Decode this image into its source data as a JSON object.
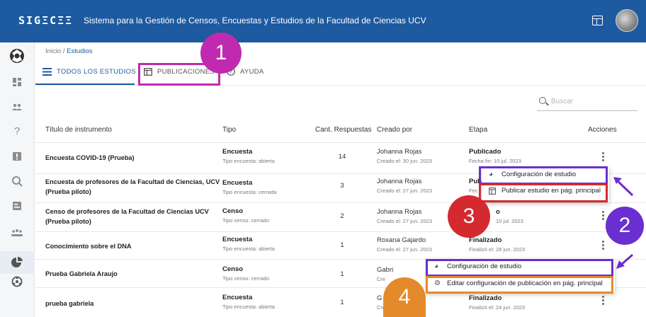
{
  "app": {
    "logo": "SIGΞCΞΞ",
    "title": "Sistema para la Gestión de Censos, Encuestas y Estudios de la Facultad de Ciencias UCV"
  },
  "breadcrumb": {
    "home": "Inicio",
    "separator": "/",
    "current": "Estudios"
  },
  "tabs": [
    {
      "label": "TODOS LOS ESTUDIOS",
      "icon": "list-icon",
      "active": true
    },
    {
      "label": "PUBLICACIONES",
      "icon": "publication-icon",
      "active": false
    },
    {
      "label": "AYUDA",
      "icon": "help-icon",
      "active": false
    }
  ],
  "search": {
    "placeholder": "Buscar"
  },
  "table": {
    "headers": [
      "Título de instrumento",
      "Tipo",
      "Cant. Respuestas",
      "Creado por",
      "Etapa",
      "Acciones"
    ],
    "rows": [
      {
        "title": "Encuesta COVID-19 (Prueba)",
        "type": "Encuesta",
        "type_sub": "Tipo encuesta: abierta",
        "count": "14",
        "by": "Johanna Rojas",
        "by_sub": "Creado el: 30 jun. 2023",
        "stage": "Publicado",
        "stage_sub": "Fecha fin: 10 jul. 2023"
      },
      {
        "title": "Encuesta de profesores de la Facultad de Ciencias, UCV (Prueba piloto)",
        "type": "Encuesta",
        "type_sub": "Tipo encuesta: cerrada",
        "count": "3",
        "by": "Johanna Rojas",
        "by_sub": "Creado el: 27 jun. 2023",
        "stage": "Pub",
        "stage_sub": "Fec"
      },
      {
        "title": "Censo de profesores de la Facultad de Ciencias UCV (Prueba piloto)",
        "type": "Censo",
        "type_sub": "Tipo censo: cerrado",
        "count": "2",
        "by": "Johanna Rojas",
        "by_sub": "Creado el: 27 jun. 2023",
        "stage": "o",
        "stage_sub": "10 jul. 2023"
      },
      {
        "title": "Conocimiento sobre el DNA",
        "type": "Encuesta",
        "type_sub": "Tipo encuesta: abierta",
        "count": "1",
        "by": "Roxana Gajardo",
        "by_sub": "Creado el: 27 jun. 2023",
        "stage": "Finalizado",
        "stage_sub": "Finalizó el: 28 jun. 2023"
      },
      {
        "title": "Prueba Gabriela Araujo",
        "type": "Censo",
        "type_sub": "Tipo censo: cerrado",
        "count": "1",
        "by": "Gabri",
        "by_sub": "Cre",
        "stage": "",
        "stage_sub": ""
      },
      {
        "title": "prueba gabriela",
        "type": "Encuesta",
        "type_sub": "Tipo encuesta: abierta",
        "count": "1",
        "by": "G",
        "by_sub": "Crea",
        "stage": "Finalizado",
        "stage_sub": "Finalizó el: 24 jun. 2023"
      }
    ]
  },
  "menu_published": [
    {
      "label": "Configuración de estudio",
      "icon": "pie-chart-icon"
    },
    {
      "label": "Publicar estudio en pág. principal",
      "icon": "publication-icon"
    }
  ],
  "menu_finished": [
    {
      "label": "Configuración de estudio",
      "icon": "pie-chart-icon"
    },
    {
      "label": "Editar configuración de publicación en pág. principal",
      "icon": "gear-icon"
    }
  ],
  "badges": {
    "one": "1",
    "two": "2",
    "three": "3",
    "four": "4"
  },
  "colors": {
    "appbar": "#1d5aa0",
    "magenta": "#c02ab0",
    "purple": "#6a2fd0",
    "red": "#d42a2f",
    "orange": "#e58a2a"
  }
}
